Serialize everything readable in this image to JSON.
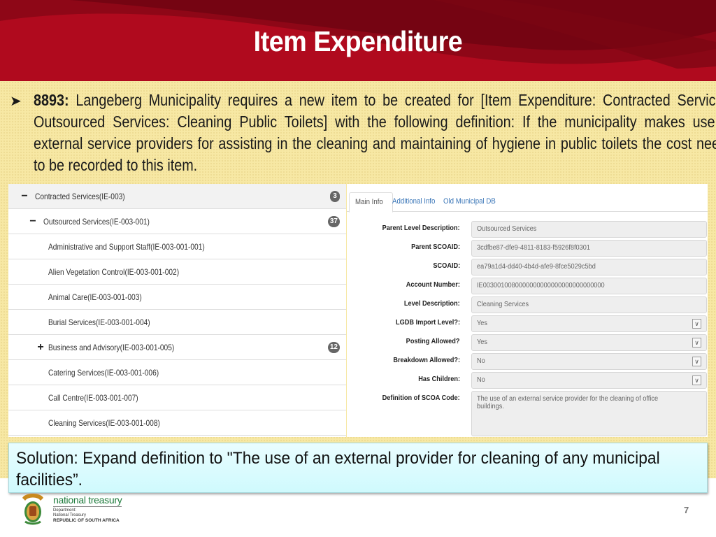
{
  "slide": {
    "title": "Item Expenditure",
    "page_number": "7"
  },
  "issue": {
    "bullet_icon": "arrow-bullet",
    "reference": "8893:",
    "text": " Langeberg Municipality requires a new item to be created for [Item Expenditure: Contracted Services: Outsourced Services: Cleaning Public Toilets] with the following definition: If the municipality makes use of external service providers for assisting in the cleaning and maintaining of hygiene in public toilets the cost needs to be recorded to this item."
  },
  "tree": {
    "items": [
      {
        "label": "Contracted Services(IE-003)",
        "toggle": "−",
        "badge": "3"
      },
      {
        "label": "Outsourced Services(IE-003-001)",
        "toggle": "−",
        "badge": "37"
      },
      {
        "label": "Administrative and Support Staff(IE-003-001-001)",
        "toggle": "",
        "badge": ""
      },
      {
        "label": "Alien Vegetation Control(IE-003-001-002)",
        "toggle": "",
        "badge": ""
      },
      {
        "label": "Animal Care(IE-003-001-003)",
        "toggle": "",
        "badge": ""
      },
      {
        "label": "Burial Services(IE-003-001-004)",
        "toggle": "",
        "badge": ""
      },
      {
        "label": "Business and Advisory(IE-003-001-005)",
        "toggle": "+",
        "badge": "12"
      },
      {
        "label": "Catering Services(IE-003-001-006)",
        "toggle": "",
        "badge": ""
      },
      {
        "label": "Call Centre(IE-003-001-007)",
        "toggle": "",
        "badge": ""
      },
      {
        "label": "Cleaning Services(IE-003-001-008)",
        "toggle": "",
        "badge": ""
      }
    ]
  },
  "detail": {
    "tabs": [
      {
        "label": "Main Info",
        "active": true
      },
      {
        "label": "Additional Info",
        "active": false
      },
      {
        "label": "Old Municipal DB",
        "active": false
      }
    ],
    "fields": [
      {
        "label": "Parent Level Description:",
        "value": "Outsourced Services",
        "type": "text"
      },
      {
        "label": "Parent SCOAID:",
        "value": "3cdfbe87-dfe9-4811-8183-f5926f8f0301",
        "type": "text"
      },
      {
        "label": "SCOAID:",
        "value": "ea79a1d4-dd40-4b4d-afe9-8fce5029c5bd",
        "type": "text"
      },
      {
        "label": "Account Number:",
        "value": "IE0030010080000000000000000000000000",
        "type": "text"
      },
      {
        "label": "Level Description:",
        "value": "Cleaning Services",
        "type": "text"
      },
      {
        "label": "LGDB Import Level?:",
        "value": "Yes",
        "type": "select"
      },
      {
        "label": "Posting Allowed?",
        "value": "Yes",
        "type": "select"
      },
      {
        "label": "Breakdown Allowed?:",
        "value": "No",
        "type": "select"
      },
      {
        "label": "Has Children:",
        "value": "No",
        "type": "select"
      },
      {
        "label": "Definition of SCOA Code:",
        "value": "The use of an external service provider for the cleaning of office buildings.",
        "type": "textarea"
      }
    ]
  },
  "solution": {
    "text": "Solution: Expand definition to \"The use of an external provider for cleaning of any municipal facilities”."
  },
  "footer": {
    "org_name": "national treasury",
    "dept_line1": "Department:",
    "dept_line2": "National Treasury",
    "country": "REPUBLIC OF SOUTH AFRICA"
  },
  "colors": {
    "header_red": "#b00a1e",
    "body_yellow": "#f7e8a4",
    "link_blue": "#3a76b8",
    "solution_cyan": "#d5fbfe",
    "treasury_green": "#1e7b3c"
  }
}
